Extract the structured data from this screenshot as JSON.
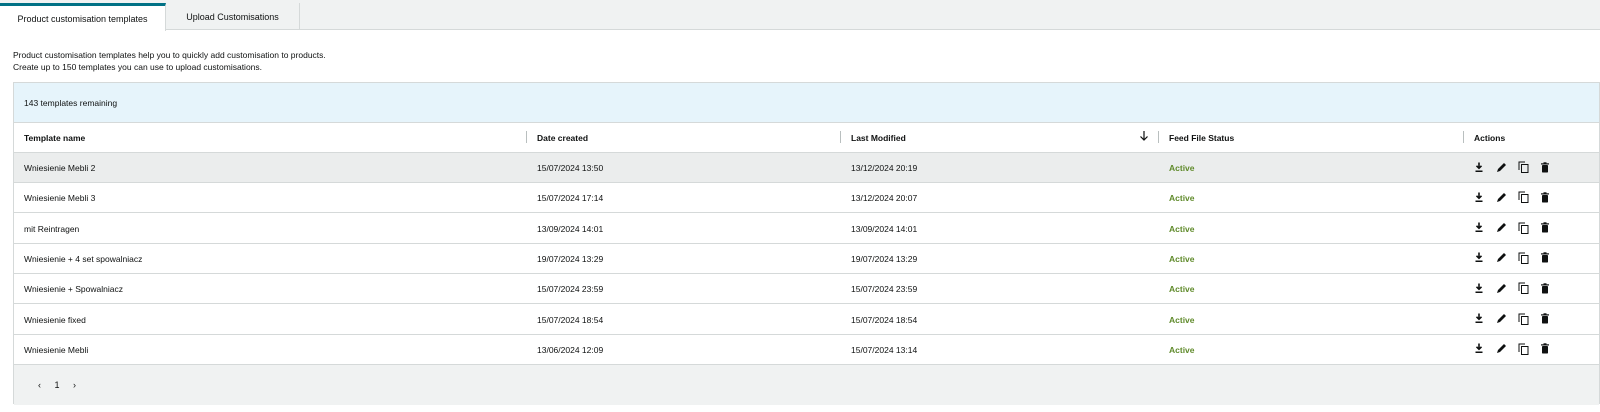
{
  "tabs": [
    {
      "label": "Product customisation templates",
      "active": true
    },
    {
      "label": "Upload Customisations",
      "active": false
    }
  ],
  "intro": {
    "line1": "Product customisation templates help you to quickly add customisation to products.",
    "line2": "Create up to 150 templates you can use to upload customisations."
  },
  "banner": {
    "text": "143 templates remaining"
  },
  "table": {
    "columns": [
      "Template name",
      "Date created",
      "Last Modified",
      "Feed File Status",
      "Actions"
    ],
    "sort_icon": "arrow-down-icon",
    "rows": [
      {
        "name": "Wniesienie Mebli 2",
        "created": "15/07/2024 13:50",
        "modified": "13/12/2024 20:19",
        "status": "Active"
      },
      {
        "name": "Wniesienie Mebli 3",
        "created": "15/07/2024 17:14",
        "modified": "13/12/2024 20:07",
        "status": "Active"
      },
      {
        "name": "mit Reintragen",
        "created": "13/09/2024 14:01",
        "modified": "13/09/2024 14:01",
        "status": "Active"
      },
      {
        "name": "Wniesienie + 4 set spowalniacz",
        "created": "19/07/2024 13:29",
        "modified": "19/07/2024 13:29",
        "status": "Active"
      },
      {
        "name": "Wniesienie + Spowalniacz",
        "created": "15/07/2024 23:59",
        "modified": "15/07/2024 23:59",
        "status": "Active"
      },
      {
        "name": "Wniesienie fixed",
        "created": "15/07/2024 18:54",
        "modified": "15/07/2024 18:54",
        "status": "Active"
      },
      {
        "name": "Wniesienie Mebli",
        "created": "13/06/2024 12:09",
        "modified": "15/07/2024 13:14",
        "status": "Active"
      }
    ],
    "action_icons": [
      "download-icon",
      "edit-icon",
      "copy-icon",
      "delete-icon"
    ]
  },
  "pagination": {
    "prev": "‹",
    "page": "1",
    "next": "›"
  },
  "colors": {
    "accent": "#007185",
    "status_active": "#5f8a2a",
    "banner_bg": "#e6f4fb"
  }
}
